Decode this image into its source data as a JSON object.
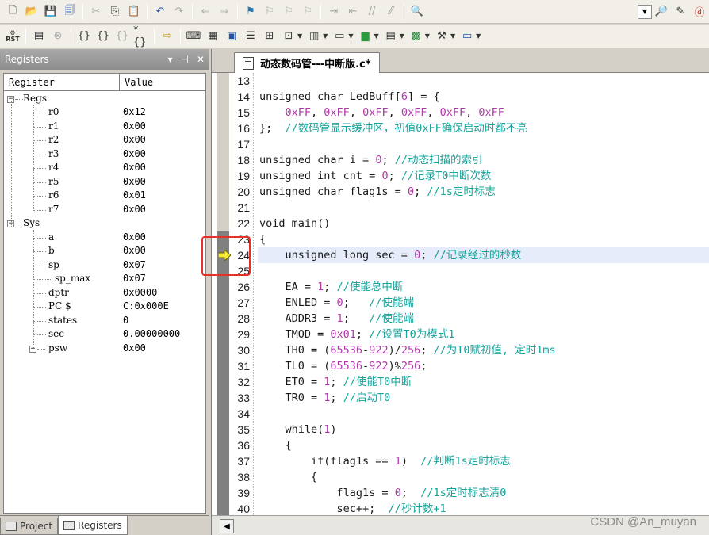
{
  "toolbar1": {
    "icons": [
      "new-file",
      "open-folder",
      "save",
      "save-all",
      "cut",
      "copy",
      "paste",
      "undo",
      "redo",
      "back",
      "forward",
      "bookmark-toggle",
      "bookmark-prev",
      "bookmark-next",
      "bookmark-clear",
      "indent",
      "unindent",
      "comment",
      "uncomment",
      "find-in-files"
    ]
  },
  "toolbar2": {
    "rst_label": "RST",
    "icons": [
      "reset",
      "run",
      "stop",
      "step-into",
      "step-over",
      "step-out",
      "run-to-cursor",
      "show-next",
      "command-window",
      "disassembly",
      "symbols",
      "registers",
      "call-stack",
      "watch",
      "memory",
      "serial",
      "analysis",
      "trace",
      "system-viewer",
      "toolbox",
      "window-layout"
    ]
  },
  "left_panel": {
    "title": "Registers",
    "header": {
      "register": "Register",
      "value": "Value"
    },
    "groups": [
      {
        "name": "Regs",
        "items": [
          {
            "name": "r0",
            "value": "0x12"
          },
          {
            "name": "r1",
            "value": "0x00"
          },
          {
            "name": "r2",
            "value": "0x00"
          },
          {
            "name": "r3",
            "value": "0x00"
          },
          {
            "name": "r4",
            "value": "0x00"
          },
          {
            "name": "r5",
            "value": "0x00"
          },
          {
            "name": "r6",
            "value": "0x01"
          },
          {
            "name": "r7",
            "value": "0x00"
          }
        ]
      },
      {
        "name": "Sys",
        "items": [
          {
            "name": "a",
            "value": "0x00"
          },
          {
            "name": "b",
            "value": "0x00"
          },
          {
            "name": "sp",
            "value": "0x07"
          },
          {
            "name": "sp_max",
            "value": "0x07"
          },
          {
            "name": "dptr",
            "value": "0x0000"
          },
          {
            "name": "PC  $",
            "value": "C:0x000E"
          },
          {
            "name": "states",
            "value": "0"
          },
          {
            "name": "sec",
            "value": "0.00000000"
          },
          {
            "name": "psw",
            "value": "0x00"
          }
        ]
      }
    ],
    "tabs": [
      {
        "label": "Project",
        "active": false
      },
      {
        "label": "Registers",
        "active": true
      }
    ]
  },
  "editor": {
    "tab_label": "动态数码管---中断版.c*",
    "current_line": 24,
    "lines": [
      {
        "n": 13,
        "t": ""
      },
      {
        "n": 14,
        "t": "unsigned char LedBuff[6] = {"
      },
      {
        "n": 15,
        "t": "    0xFF, 0xFF, 0xFF, 0xFF, 0xFF, 0xFF"
      },
      {
        "n": 16,
        "t": "};  //数码管显示缓冲区，初值0xFF确保启动时都不亮"
      },
      {
        "n": 17,
        "t": ""
      },
      {
        "n": 18,
        "t": "unsigned char i = 0; //动态扫描的索引"
      },
      {
        "n": 19,
        "t": "unsigned int cnt = 0; //记录T0中断次数"
      },
      {
        "n": 20,
        "t": "unsigned char flag1s = 0; //1s定时标志"
      },
      {
        "n": 21,
        "t": ""
      },
      {
        "n": 22,
        "t": "void main()"
      },
      {
        "n": 23,
        "t": "{"
      },
      {
        "n": 24,
        "t": "    unsigned long sec = 0; //记录经过的秒数"
      },
      {
        "n": 25,
        "t": ""
      },
      {
        "n": 26,
        "t": "    EA = 1; //使能总中断"
      },
      {
        "n": 27,
        "t": "    ENLED = 0;   //使能端"
      },
      {
        "n": 28,
        "t": "    ADDR3 = 1;   //使能端"
      },
      {
        "n": 29,
        "t": "    TMOD = 0x01; //设置T0为模式1"
      },
      {
        "n": 30,
        "t": "    TH0 = (65536-922)/256; //为T0赋初值, 定时1ms"
      },
      {
        "n": 31,
        "t": "    TL0 = (65536-922)%256;"
      },
      {
        "n": 32,
        "t": "    ET0 = 1; //使能T0中断"
      },
      {
        "n": 33,
        "t": "    TR0 = 1; //启动T0"
      },
      {
        "n": 34,
        "t": ""
      },
      {
        "n": 35,
        "t": "    while(1)"
      },
      {
        "n": 36,
        "t": "    {"
      },
      {
        "n": 37,
        "t": "        if(flag1s == 1)  //判断1s定时标志"
      },
      {
        "n": 38,
        "t": "        {"
      },
      {
        "n": 39,
        "t": "            flag1s = 0;  //1s定时标志清0"
      },
      {
        "n": 40,
        "t": "            sec++;  //秒计数+1"
      }
    ]
  },
  "watermark": "CSDN @An_muyan"
}
